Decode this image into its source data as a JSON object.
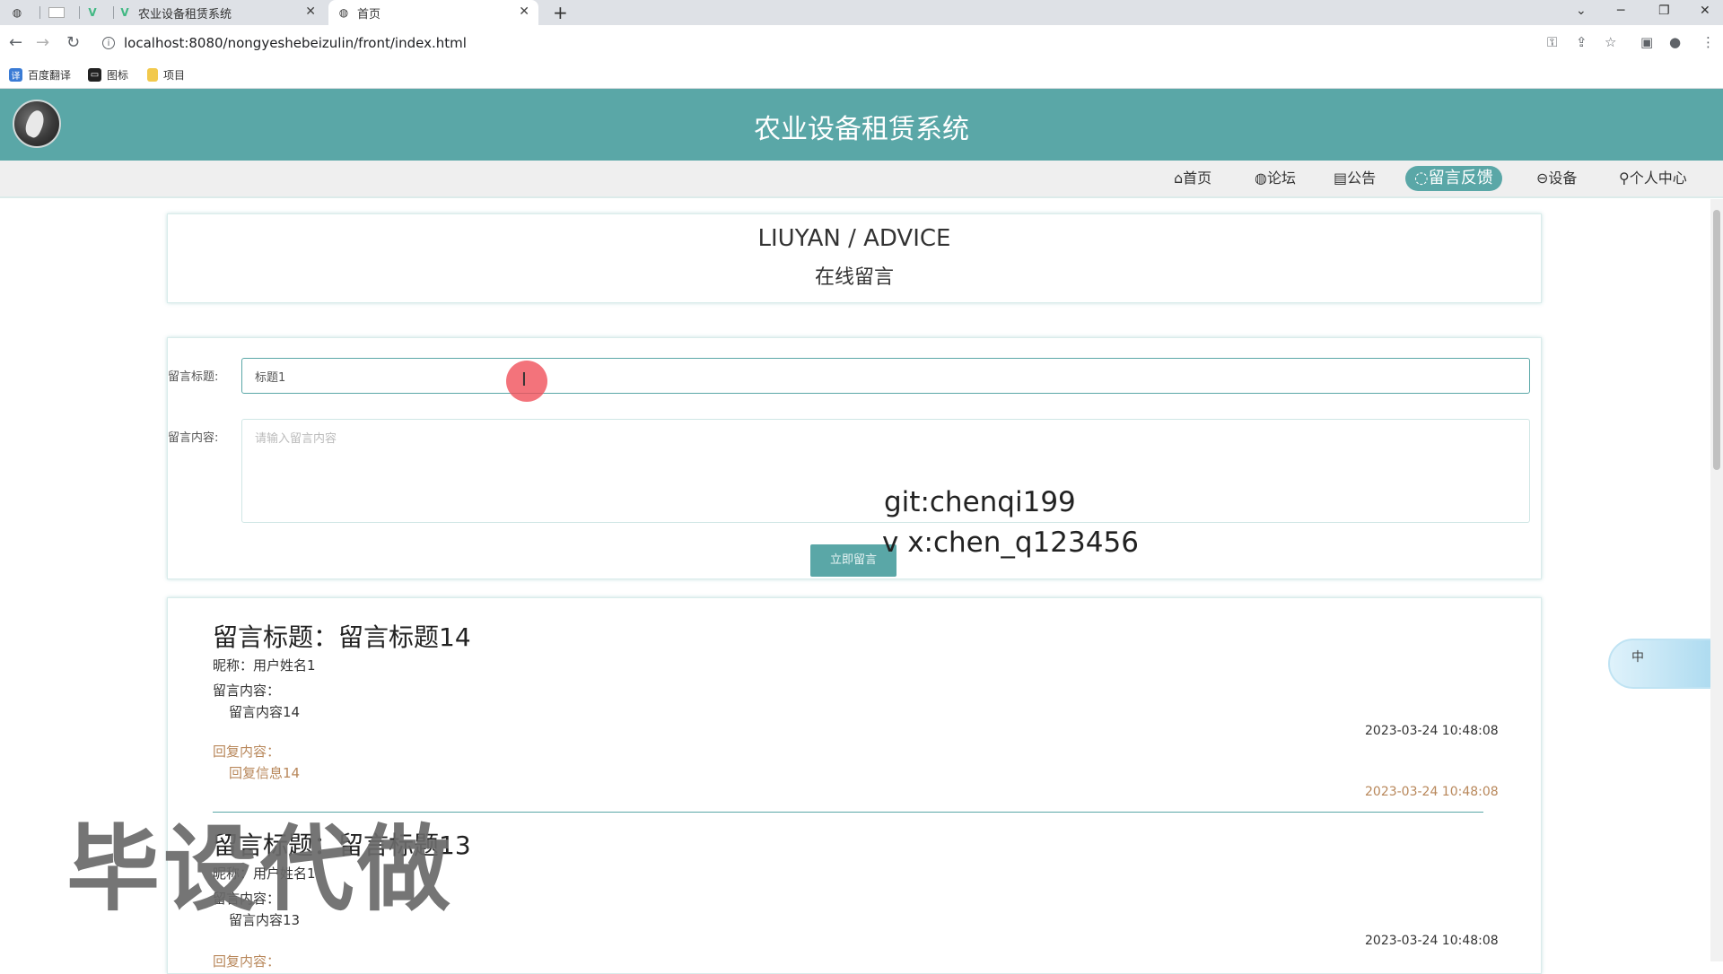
{
  "browser": {
    "tabs": [
      {
        "title": "",
        "icon": "globe-icon"
      },
      {
        "title": "",
        "icon": "blank-page-icon"
      },
      {
        "title": "",
        "icon": "vue-icon"
      },
      {
        "title": "农业设备租赁系统",
        "icon": "vue-icon"
      },
      {
        "title": "首页",
        "icon": "globe-icon"
      }
    ],
    "new_tab": "+",
    "url": "localhost:8080/nongyeshebeizulin/front/index.html",
    "bookmarks": [
      "百度翻译",
      "图标",
      "项目"
    ]
  },
  "site": {
    "title": "农业设备租赁系统"
  },
  "nav": {
    "items": [
      {
        "label": "⌂首页"
      },
      {
        "label": "◍论坛"
      },
      {
        "label": "▤公告"
      },
      {
        "label": "◌留言反馈"
      },
      {
        "label": "⊖设备"
      },
      {
        "label": "⚲个人中心"
      }
    ],
    "active_index": 3
  },
  "section": {
    "title_en": "LIUYAN / ADVICE",
    "title_cn": "在线留言"
  },
  "form": {
    "title_label": "留言标题:",
    "title_value": "标题1",
    "content_label": "留言内容:",
    "content_placeholder": "请输入留言内容",
    "submit_label": "立即留言"
  },
  "watermarks": {
    "git": "git:chenqi199",
    "vx": "v x:chen_q123456",
    "big": "毕设代做"
  },
  "messages": [
    {
      "title": "留言标题：留言标题14",
      "nickname": "昵称：用户姓名1",
      "content_label": "留言内容：",
      "content": "留言内容14",
      "time": "2023-03-24 10:48:08",
      "reply_label": "回复内容：",
      "reply": "回复信息14",
      "reply_time": "2023-03-24 10:48:08"
    },
    {
      "title": "留言标题：留言标题13",
      "nickname": "昵称：用户姓名1",
      "content_label": "留言内容：",
      "content": "留言内容13",
      "time": "2023-03-24 10:48:08",
      "reply_label": "回复内容："
    }
  ],
  "widget": {
    "label": "中"
  },
  "colors": {
    "brand": "#5aa7a7",
    "reply": "#b8875a"
  }
}
